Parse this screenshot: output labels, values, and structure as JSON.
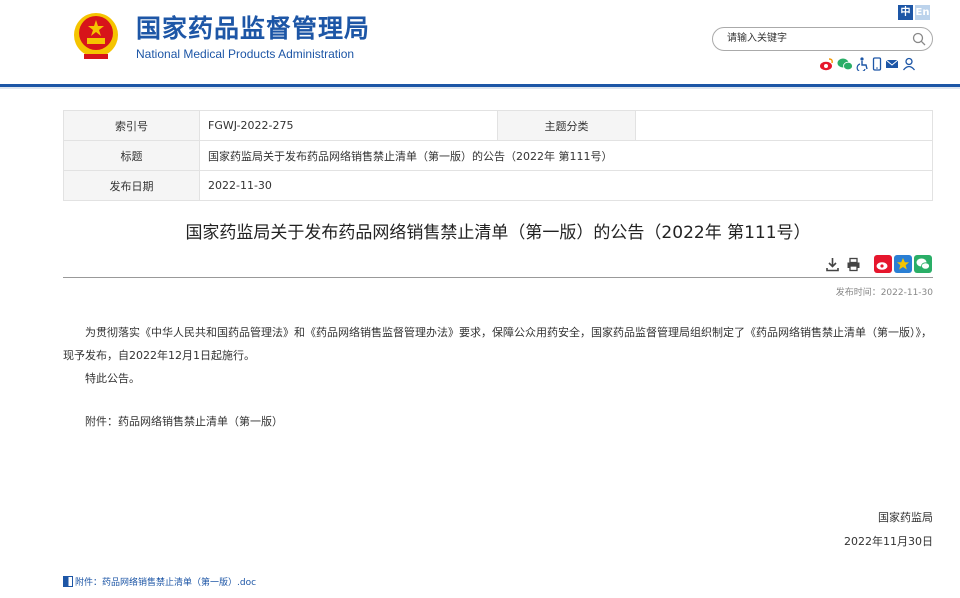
{
  "header": {
    "title_cn": "国家药品监督管理局",
    "title_en": "National Medical Products Administration",
    "lang_zh": "中",
    "lang_en": "En",
    "search_placeholder": "请输入关键字",
    "social_icons": [
      "weibo-icon",
      "wechat-icon",
      "accessibility-icon",
      "mobile-icon",
      "mail-icon",
      "user-icon"
    ]
  },
  "info": {
    "index_label": "索引号",
    "index_value": "FGWJ-2022-275",
    "topic_label": "主题分类",
    "topic_value": "",
    "title_label": "标题",
    "title_value": "国家药监局关于发布药品网络销售禁止清单（第一版）的公告（2022年 第111号）",
    "date_label": "发布日期",
    "date_value": "2022-11-30"
  },
  "article": {
    "title": "国家药监局关于发布药品网络销售禁止清单（第一版）的公告（2022年 第111号）",
    "publish_time": "发布时间：2022-11-30",
    "para1": "为贯彻落实《中华人民共和国药品管理法》和《药品网络销售监督管理办法》要求，保障公众用药安全，国家药品监督管理局组织制定了《药品网络销售禁止清单（第一版）》，现予发布，自2022年12月1日起施行。",
    "para2": "特此公告。",
    "attachment_line": "附件：药品网络销售禁止清单（第一版）",
    "signer": "国家药监局",
    "sign_date": "2022年11月30日",
    "attachment_link": "附件：药品网络销售禁止清单（第一版）.doc"
  },
  "colors": {
    "brand": "#1d56a6",
    "emblem_red": "#d7141a",
    "gold": "#f5c400"
  }
}
